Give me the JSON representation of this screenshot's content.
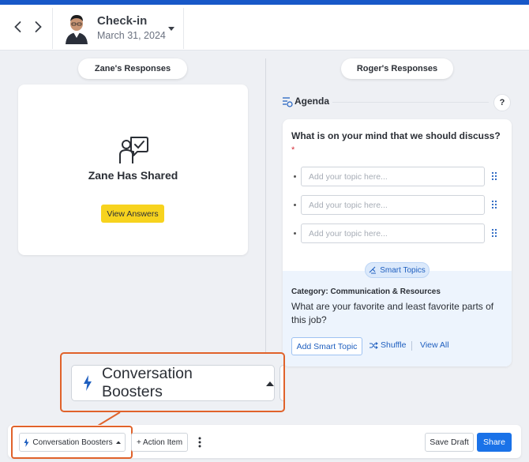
{
  "header": {
    "title": "Check-in",
    "date": "March 31, 2024",
    "prev_icon": "chevron-left-icon",
    "next_icon": "chevron-right-icon",
    "accent_color": "#1858c8"
  },
  "left": {
    "pill_label": "Zane's Responses",
    "shared_text": "Zane Has Shared",
    "view_answers_label": "View Answers",
    "icon": "shared-feedback-icon"
  },
  "right": {
    "pill_label": "Roger's Responses",
    "agenda_title": "Agenda",
    "help_label": "?",
    "question": "What is on your mind that we should discuss?",
    "required_mark": "*",
    "topics": [
      {
        "placeholder": "Add your topic here...",
        "value": ""
      },
      {
        "placeholder": "Add your topic here...",
        "value": ""
      },
      {
        "placeholder": "Add your topic here...",
        "value": ""
      }
    ],
    "smart_topics_label": "Smart Topics",
    "category": "Category: Communication & Resources",
    "smart_question": "What are your favorite and least favorite parts of this job?",
    "add_smart_topic_label": "Add Smart Topic",
    "shuffle_label": "Shuffle",
    "view_all_label": "View All"
  },
  "zoom": {
    "label": "Conversation Boosters"
  },
  "footer": {
    "conversation_boosters_label": "Conversation Boosters",
    "action_item_label": "+ Action Item",
    "save_draft_label": "Save Draft",
    "share_label": "Share"
  },
  "colors": {
    "highlight": "#e0622a",
    "primary": "#1a72e8",
    "yellow": "#f7d31e"
  }
}
